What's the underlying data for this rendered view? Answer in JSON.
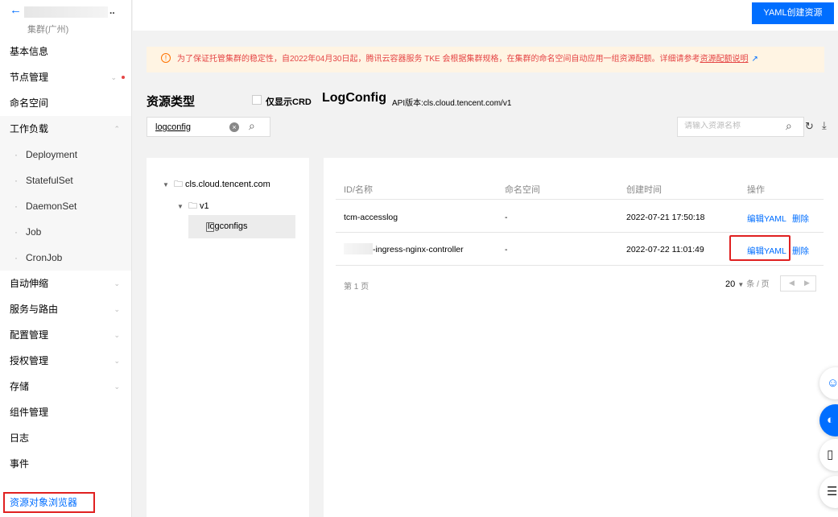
{
  "sidebar": {
    "back": "←",
    "cluster_more": "..",
    "cluster_region": "集群(广州)",
    "items": [
      {
        "label": "基本信息"
      },
      {
        "label": "节点管理"
      },
      {
        "label": "命名空间"
      },
      {
        "label": "工作负载"
      }
    ],
    "workload_children": [
      "Deployment",
      "StatefulSet",
      "DaemonSet",
      "Job",
      "CronJob"
    ],
    "items_after": [
      {
        "label": "自动伸缩"
      },
      {
        "label": "服务与路由"
      },
      {
        "label": "配置管理"
      },
      {
        "label": "授权管理"
      },
      {
        "label": "存储"
      },
      {
        "label": "组件管理"
      },
      {
        "label": "日志"
      },
      {
        "label": "事件"
      }
    ],
    "active_item": "资源对象浏览器"
  },
  "header": {
    "yaml_create_button": "YAML创建资源"
  },
  "notice": {
    "icon": "!",
    "text": "为了保证托管集群的稳定性，自2022年04月30日起，腾讯云容器服务 TKE 会根据集群规格，在集群的命名空间自动应用一组资源配额。详细请参考",
    "link": "资源配额说明",
    "external_icon": "↗"
  },
  "resource_panel": {
    "title": "资源类型",
    "crd_only_label": "仅显示CRD",
    "kind": "LogConfig",
    "api_version": "API版本:cls.cloud.tencent.com/v1",
    "search_value": "logconfig",
    "clear_icon": "×",
    "search_icon": "⌕"
  },
  "tree": {
    "group": "cls.cloud.tencent.com",
    "version": "v1",
    "resource": "logconfigs"
  },
  "table": {
    "search_placeholder": "请输入资源名称",
    "columns": [
      "ID/名称",
      "命名空间",
      "创建时间",
      "操作"
    ],
    "rows": [
      {
        "name": "tcm-accesslog",
        "namespace": "-",
        "created": "2022-07-21 17:50:18",
        "edit": "编辑YAML",
        "delete": "删除"
      },
      {
        "name": "-ingress-nginx-controller",
        "namespace": "-",
        "created": "2022-07-22 11:01:49",
        "edit": "编辑YAML",
        "delete": "删除"
      }
    ],
    "page_label": "第 1 页",
    "page_size": "20",
    "page_size_unit": "条 / 页",
    "prev": "◀",
    "next": "▶"
  },
  "colors": {
    "accent": "#006eff",
    "highlight_border": "#e02020",
    "notice_bg": "#fff4e3",
    "notice_text": "#e54545"
  },
  "icons": [
    "back-arrow-icon",
    "warning-icon",
    "external-link-icon",
    "search-icon",
    "clear-icon",
    "refresh-icon",
    "download-icon",
    "folder-icon",
    "file-icon",
    "smile-icon",
    "support-icon",
    "docs-icon",
    "list-icon"
  ]
}
